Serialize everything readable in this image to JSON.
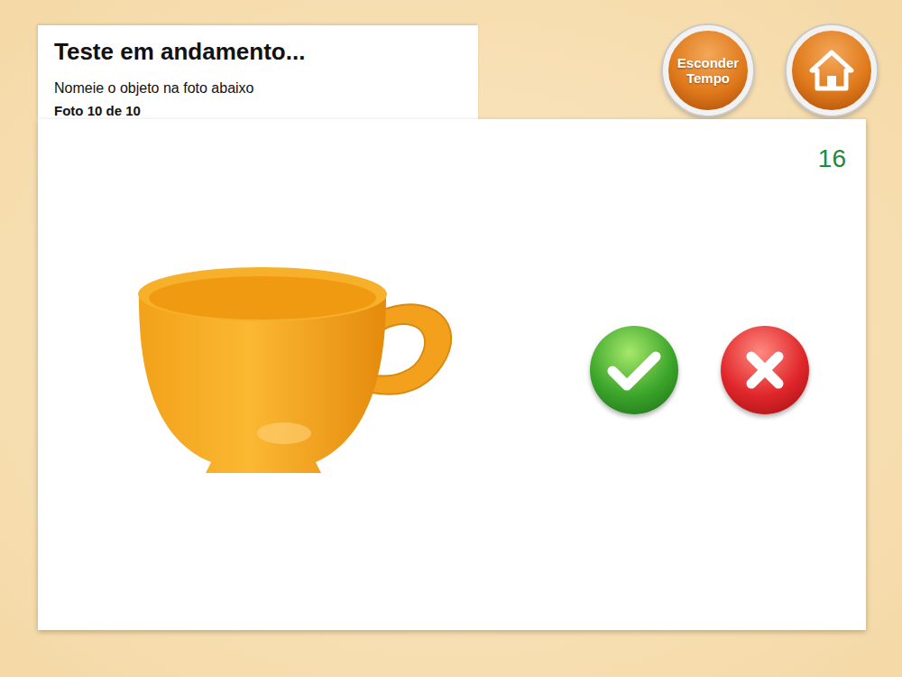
{
  "header": {
    "title": "Teste em andamento...",
    "instruction": "Nomeie o objeto na foto abaixo",
    "progress": "Foto 10 de 10"
  },
  "toolbar": {
    "hide_time_button": "Esconder Tempo"
  },
  "timer": "16"
}
